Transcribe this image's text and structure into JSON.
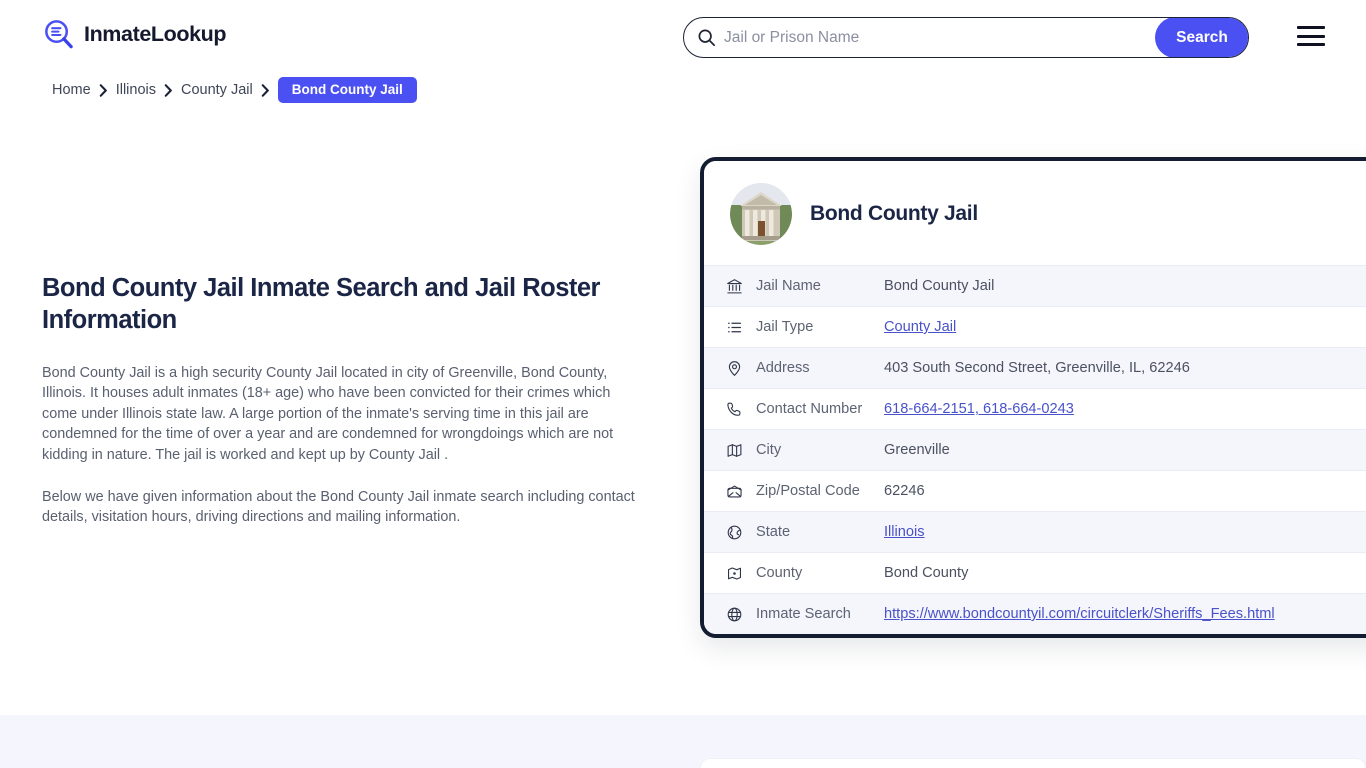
{
  "header": {
    "brand_name": "InmateLookup",
    "brand_icon": "magnifier-list-logo-icon",
    "search": {
      "placeholder": "Jail or Prison Name",
      "value": "",
      "icon": "search-icon",
      "button_label": "Search"
    },
    "menu_icon": "hamburger-menu-icon"
  },
  "breadcrumb": {
    "items": [
      {
        "label": "Home",
        "current": false
      },
      {
        "label": "Illinois",
        "current": false
      },
      {
        "label": "County Jail",
        "current": false
      },
      {
        "label": "Bond County Jail",
        "current": true
      }
    ],
    "separator_icon": "chevron-right-icon"
  },
  "main": {
    "page_title": "Bond County Jail Inmate Search and Jail Roster Information",
    "paragraphs": [
      "Bond County Jail is a high security County Jail located in city of Greenville, Bond County, Illinois. It houses adult inmates (18+ age) who have been convicted for their crimes which come under Illinois state law. A large portion of the inmate's serving time in this jail are condemned for the time of over a year and are condemned for wrongdoings which are not kidding in nature. The jail is worked and kept up by County Jail .",
      "Below we have given information about the Bond County Jail inmate search including contact details, visitation hours, driving directions and mailing information."
    ]
  },
  "info_card": {
    "avatar_icon": "courthouse-photo-avatar",
    "title": "Bond County Jail",
    "rows": [
      {
        "icon": "bank-icon",
        "label": "Jail Name",
        "value": "Bond County Jail",
        "link": false
      },
      {
        "icon": "list-icon",
        "label": "Jail Type",
        "value": "County Jail",
        "link": true
      },
      {
        "icon": "map-pin-icon",
        "label": "Address",
        "value": "403 South Second Street, Greenville, IL, 62246",
        "link": false
      },
      {
        "icon": "phone-icon",
        "label": "Contact Number",
        "value": "618-664-2151, 618-664-0243",
        "link": true
      },
      {
        "icon": "map-icon",
        "label": "City",
        "value": "Greenville",
        "link": false
      },
      {
        "icon": "envelope-icon",
        "label": "Zip/Postal Code",
        "value": "62246",
        "link": false
      },
      {
        "icon": "globe-state-icon",
        "label": "State",
        "value": "Illinois",
        "link": true
      },
      {
        "icon": "region-icon",
        "label": "County",
        "value": "Bond County",
        "link": false
      },
      {
        "icon": "globe-icon",
        "label": "Inmate Search",
        "value": "https://www.bondcountyil.com/circuitclerk/Sheriffs_Fees.html",
        "link": true
      }
    ]
  },
  "colors": {
    "accent_blue": "#4b50f2",
    "card_border_navy": "#141c32",
    "row_alt_lavender": "#f5f5fc",
    "link_blue": "#4952c8",
    "heading_navy": "#1b2546",
    "body_gray": "#5a6070",
    "footer_band": "#f5f5fd"
  }
}
